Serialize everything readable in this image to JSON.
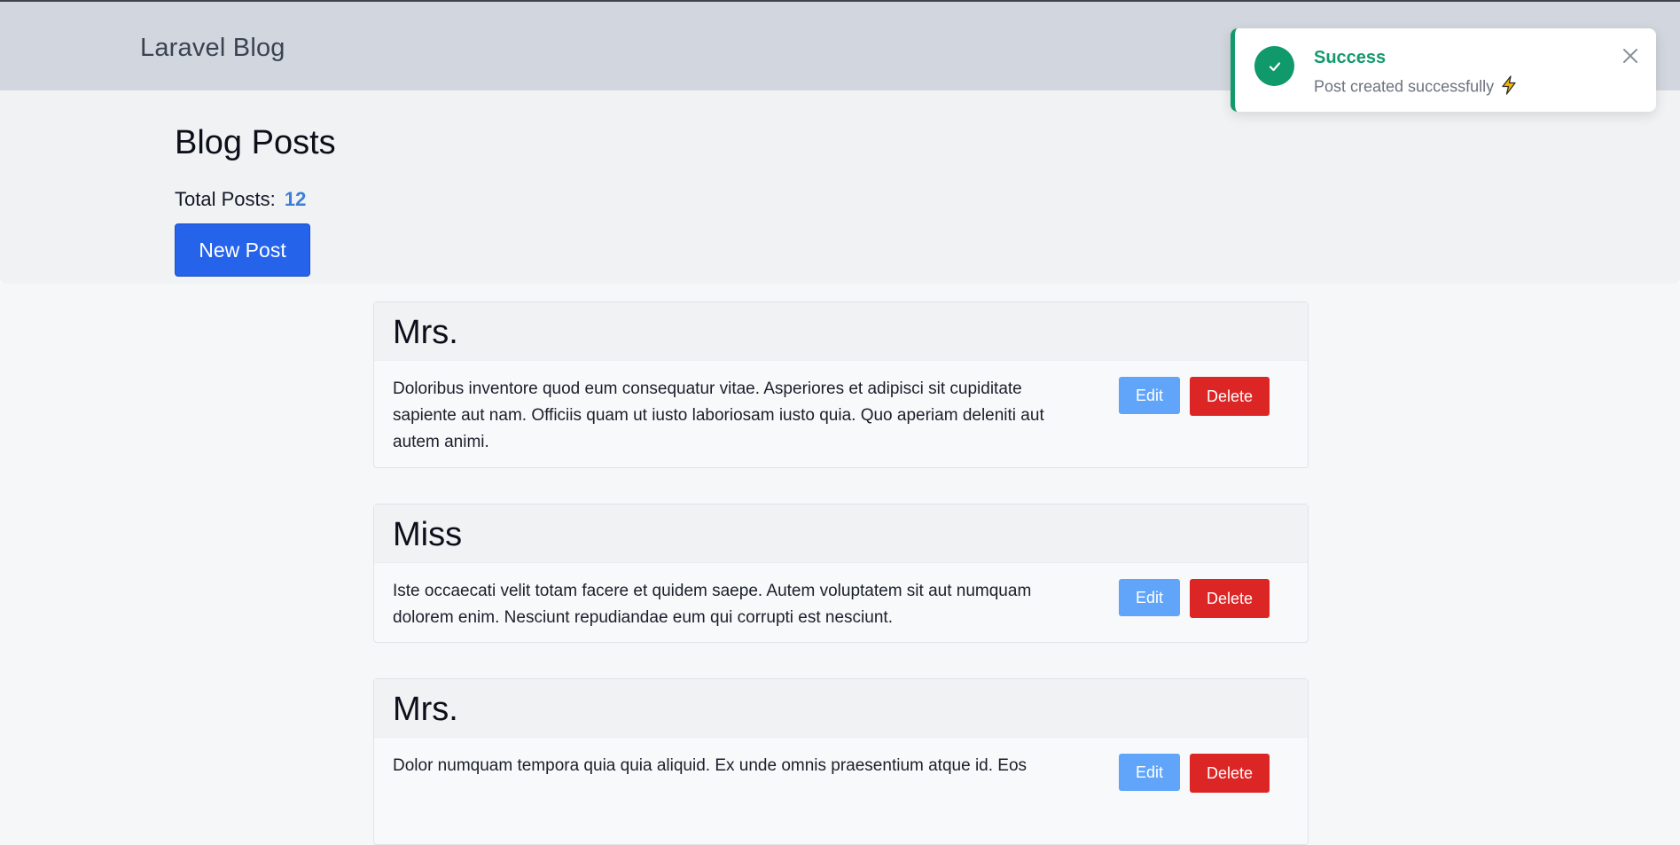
{
  "navbar": {
    "brand": "Laravel Blog"
  },
  "header": {
    "title": "Blog Posts",
    "total_label": "Total Posts:",
    "total_count": "12",
    "new_post_label": "New Post"
  },
  "toast": {
    "title": "Success",
    "message": "Post created successfully",
    "icon": "check-icon",
    "accent": "#139a6b"
  },
  "posts": [
    {
      "title": "Mrs.",
      "body": "Doloribus inventore quod eum consequatur vitae. Asperiores et adipisci sit cupiditate sapiente aut nam. Officiis quam ut iusto laboriosam iusto quia. Quo aperiam deleniti aut autem animi.",
      "edit_label": "Edit",
      "delete_label": "Delete"
    },
    {
      "title": "Miss",
      "body": "Iste occaecati velit totam facere et quidem saepe. Autem voluptatem sit aut numquam dolorem enim. Nesciunt repudiandae eum qui corrupti est nesciunt.",
      "edit_label": "Edit",
      "delete_label": "Delete"
    },
    {
      "title": "Mrs.",
      "body": "Dolor numquam tempora quia quia aliquid. Ex unde omnis praesentium atque id. Eos",
      "edit_label": "Edit",
      "delete_label": "Delete"
    }
  ],
  "colors": {
    "primary": "#2563eb",
    "edit": "#60a5fa",
    "delete": "#dc2626",
    "navbar": "#d2d6de",
    "count": "#3d7fd6"
  }
}
